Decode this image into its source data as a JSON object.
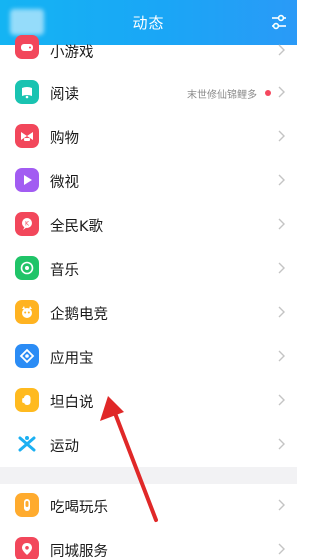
{
  "header": {
    "title": "动态"
  },
  "items": [
    {
      "label": "小游戏",
      "icon": "game-icon",
      "color": "#f2475b"
    },
    {
      "label": "阅读",
      "icon": "reading-icon",
      "color": "#19c3b1",
      "hint": "末世修仙锦鲤多",
      "dot": true
    },
    {
      "label": "购物",
      "icon": "shopping-icon",
      "color": "#f2475b"
    },
    {
      "label": "微视",
      "icon": "weishi-icon",
      "color": "#a25cf2"
    },
    {
      "label": "全民K歌",
      "icon": "karaoke-icon",
      "color": "#f2475b"
    },
    {
      "label": "音乐",
      "icon": "music-icon",
      "color": "#20c468"
    },
    {
      "label": "企鹅电竞",
      "icon": "esports-icon",
      "color": "#ffb321"
    },
    {
      "label": "应用宝",
      "icon": "appstore-icon",
      "color": "#2b8cf5"
    },
    {
      "label": "坦白说",
      "icon": "confess-icon",
      "color": "#ffba1f"
    },
    {
      "label": "运动",
      "icon": "sports-icon",
      "color": "#1cb0f2"
    },
    {
      "label": "吃喝玩乐",
      "icon": "food-icon",
      "color": "#ffab2e"
    },
    {
      "label": "同城服务",
      "icon": "location-icon",
      "color": "#f2475b"
    }
  ]
}
